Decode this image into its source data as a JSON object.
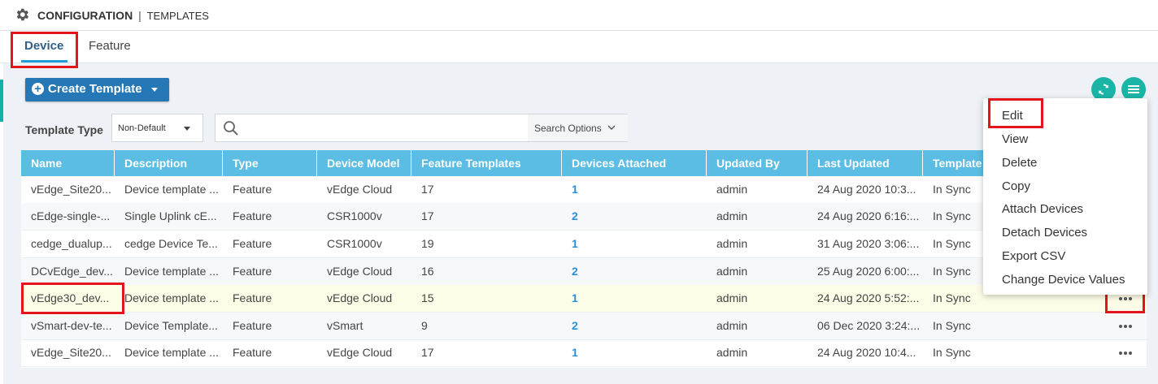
{
  "header": {
    "title": "CONFIGURATION",
    "separator": "|",
    "subtitle": "TEMPLATES",
    "icon": "gear-icon"
  },
  "tabs": [
    {
      "label": "Device",
      "active": true
    },
    {
      "label": "Feature",
      "active": false
    }
  ],
  "toolbar": {
    "create_label": "Create Template",
    "refresh_icon": "refresh-icon",
    "menu_icon": "hamburger-menu-icon"
  },
  "filters": {
    "template_type_label": "Template Type",
    "template_type_value": "Non-Default",
    "search_placeholder": "",
    "search_options_label": "Search Options"
  },
  "table": {
    "columns": [
      "Name",
      "Description",
      "Type",
      "Device Model",
      "Feature Templates",
      "Devices Attached",
      "Updated By",
      "Last Updated",
      "Template"
    ],
    "rows": [
      [
        "vEdge_Site20...",
        "Device template ...",
        "Feature",
        "vEdge Cloud",
        "17",
        "1",
        "admin",
        "24 Aug 2020 10:3...",
        "In Sync"
      ],
      [
        "cEdge-single-...",
        "Single Uplink cE...",
        "Feature",
        "CSR1000v",
        "17",
        "2",
        "admin",
        "24 Aug 2020 6:16:...",
        "In Sync"
      ],
      [
        "cedge_dualup...",
        "cedge Device Te...",
        "Feature",
        "CSR1000v",
        "19",
        "1",
        "admin",
        "31 Aug 2020 3:06:...",
        "In Sync"
      ],
      [
        "DCvEdge_dev...",
        "Device template ...",
        "Feature",
        "vEdge Cloud",
        "16",
        "2",
        "admin",
        "25 Aug 2020 6:00:...",
        "In Sync"
      ],
      [
        "vEdge30_dev...",
        "Device template ...",
        "Feature",
        "vEdge Cloud",
        "15",
        "1",
        "admin",
        "24 Aug 2020 5:52:...",
        "In Sync"
      ],
      [
        "vSmart-dev-te...",
        "Device Template...",
        "Feature",
        "vSmart",
        "9",
        "2",
        "admin",
        "06 Dec 2020 3:24:...",
        "In Sync"
      ],
      [
        "vEdge_Site20...",
        "Device template ...",
        "Feature",
        "vEdge Cloud",
        "17",
        "1",
        "admin",
        "24 Aug 2020 10:4...",
        "In Sync"
      ]
    ]
  },
  "context_menu": {
    "items": [
      "Edit",
      "View",
      "Delete",
      "Copy",
      "Attach Devices",
      "Detach Devices",
      "Export CSV",
      "Change Device Values"
    ]
  },
  "colors": {
    "accent": "#2577b5",
    "table_header": "#5bbde3",
    "teal": "#1bb5a8",
    "highlight_box": "#e3141c",
    "link": "#2b8fd6"
  }
}
